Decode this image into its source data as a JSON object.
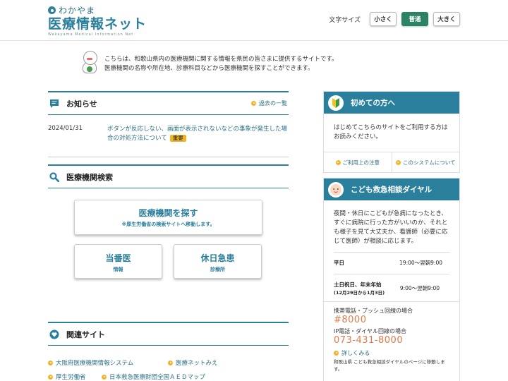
{
  "header": {
    "logo_sub": "わかやま",
    "logo_main": "医療情報ネット",
    "logo_en": "Wakayama Medical Information Net",
    "fontsize_label": "文字サイズ",
    "fontsize_small": "小さく",
    "fontsize_normal": "普通",
    "fontsize_large": "大きく"
  },
  "intro": {
    "line1": "こちらは、和歌山県内の医療機関に関する情報を県民の皆さまに提供するサイトです。",
    "line2": "医療機関の名称や所在地、診療科目などから医療機関を探すことができます。"
  },
  "news": {
    "title": "お知らせ",
    "archive_link": "過去の一覧",
    "items": [
      {
        "date": "2024/01/31",
        "text": "ボタンが反応しない、画面が表示されないなどの事象が発生した場合の対処方法について",
        "badge": "重要"
      }
    ]
  },
  "search": {
    "title": "医療機関検索",
    "main_button_title": "医療機関を探す",
    "main_button_sub": "※厚生労働省の検索サイトへ移動します。",
    "duty_title": "当番医",
    "duty_sub": "情報",
    "holiday_title": "休日急患",
    "holiday_sub": "診療所"
  },
  "related": {
    "title": "関連サイト",
    "links": [
      "大阪府医療機関情報システム",
      "医療ネットみえ",
      "厚生労働省",
      "日本救急医療財団全国ＡＥＤマップ"
    ]
  },
  "first_time": {
    "title": "初めての方へ",
    "text": "はじめてこちらのサイトをご利用する方はお読みください。",
    "link1": "ご利用上の注意",
    "link2": "このシステムについて"
  },
  "kids": {
    "title": "こども救急相談ダイヤル",
    "text": "夜間・休日にこどもが急病になったとき、すぐに病院に行った方がいいのか、それとも様子を見て大丈夫か、看護師（必要に応じて医師）が相談に応じます。",
    "weekday_label": "平日",
    "weekday_hours": "19:00～翌朝9:00",
    "holiday_label": "土日祝日、年末年始",
    "holiday_note": "(12月29日から1月3日)",
    "holiday_hours": "9:00～翌朝9:00",
    "mobile_label": "携帯電話・プッシュ回線の場合",
    "mobile_number": "#8000",
    "ip_label": "IP電話・ダイヤル回線の場合",
    "ip_number": "073-431-8000",
    "more_link": "詳しくみる",
    "more_note": "和歌山県 こども救急相談ダイヤルのページに移動します。"
  },
  "colors": {
    "primary": "#2a7f9c",
    "accent": "#f0b429",
    "active_button": "#2b8366",
    "phone": "#e07a4a"
  }
}
